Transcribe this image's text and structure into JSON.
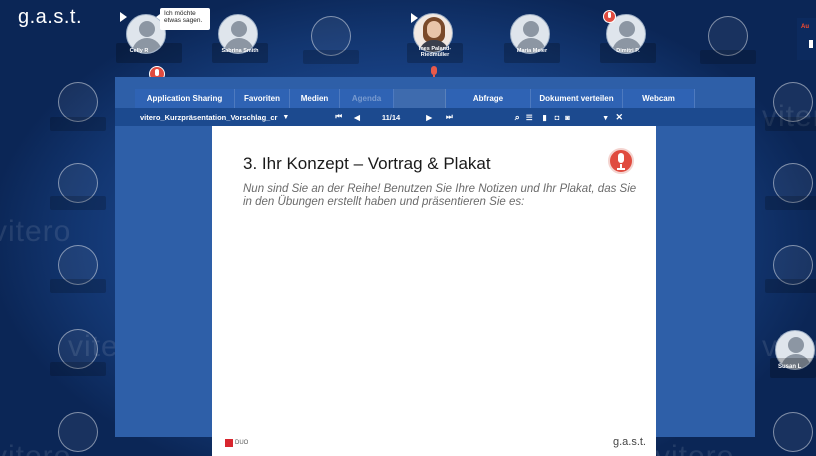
{
  "brand": "g.a.s.t.",
  "background_watermark": "vitero",
  "seats_top": [
    {
      "name": "Celly R"
    },
    {
      "name": "Sabrina Smith"
    },
    {
      "name": ""
    },
    {
      "name": "Ines Paland-Riedmüller"
    },
    {
      "name": "Maria Meier"
    },
    {
      "name": "Dimitri P."
    },
    {
      "name": ""
    }
  ],
  "speech_bubble": "Ich möchte etwas sagen.",
  "tabs": [
    "Application Sharing",
    "Favoriten",
    "Medien",
    "Agenda",
    "",
    "Abfrage",
    "Dokument verteilen",
    "Webcam"
  ],
  "controls": {
    "document_name": "vitero_Kurzpräsentation_Vorschlag_cr",
    "page_indicator": "11/14"
  },
  "slide": {
    "title": "3. Ihr Konzept – Vortrag & Plakat",
    "body": "Nun sind Sie an der Reihe! Benutzen Sie Ihre Notizen und Ihr Plakat, das Sie in den Übungen erstellt haben und präsentieren Sie es:",
    "footer_left": "DUO",
    "footer_right": "g.a.s.t."
  },
  "right_seat_name": "Susan L",
  "corner_label": "Au",
  "icons": [
    "flag-icon",
    "microphone-icon",
    "first-page-icon",
    "prev-page-icon",
    "next-page-icon",
    "last-page-icon",
    "search-icon",
    "list-icon",
    "close-icon",
    "dropdown-icon"
  ]
}
